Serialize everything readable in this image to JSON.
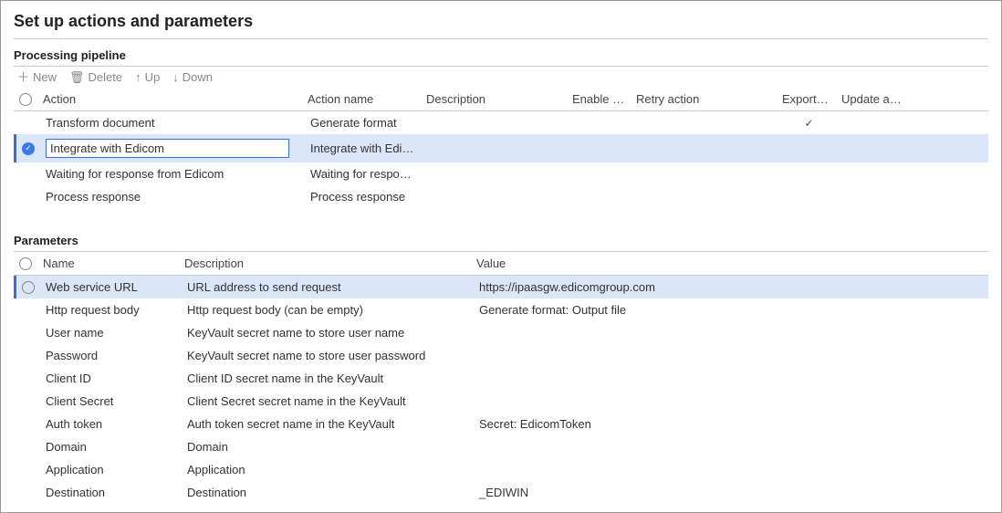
{
  "page": {
    "title": "Set up actions and parameters"
  },
  "pipeline": {
    "label": "Processing pipeline",
    "toolbar": {
      "new": "New",
      "delete": "Delete",
      "up": "Up",
      "down": "Down"
    },
    "headers": {
      "action": "Action",
      "action_name": "Action name",
      "description": "Description",
      "enable_retry": "Enable retry",
      "retry_action": "Retry action",
      "export_result": "Export result",
      "update_act": "Update act..."
    },
    "rows": [
      {
        "selected": false,
        "action": "Transform document",
        "action_name": "Generate format",
        "description": "",
        "enable_retry": "",
        "retry_action": "",
        "export_result": "✓",
        "update_act": ""
      },
      {
        "selected": true,
        "action": "Integrate with Edicom",
        "action_name": "Integrate with Edicom",
        "description": "",
        "enable_retry": "",
        "retry_action": "",
        "export_result": "",
        "update_act": ""
      },
      {
        "selected": false,
        "action": "Waiting for response from Edicom",
        "action_name": "Waiting for response fro...",
        "description": "",
        "enable_retry": "",
        "retry_action": "",
        "export_result": "",
        "update_act": ""
      },
      {
        "selected": false,
        "action": "Process response",
        "action_name": "Process response",
        "description": "",
        "enable_retry": "",
        "retry_action": "",
        "export_result": "",
        "update_act": ""
      }
    ]
  },
  "parameters": {
    "label": "Parameters",
    "headers": {
      "name": "Name",
      "description": "Description",
      "value": "Value"
    },
    "rows": [
      {
        "selected": true,
        "name": "Web service URL",
        "description": "URL address to send request",
        "value": "https://ipaasgw.edicomgroup.com"
      },
      {
        "selected": false,
        "name": "Http request body",
        "description": "Http request body (can be empty)",
        "value": "Generate format: Output file"
      },
      {
        "selected": false,
        "name": "User name",
        "description": "KeyVault secret name to store user name",
        "value": ""
      },
      {
        "selected": false,
        "name": "Password",
        "description": "KeyVault secret name to store user password",
        "value": ""
      },
      {
        "selected": false,
        "name": "Client ID",
        "description": "Client ID secret name in the KeyVault",
        "value": ""
      },
      {
        "selected": false,
        "name": "Client Secret",
        "description": "Client Secret secret name in the KeyVault",
        "value": ""
      },
      {
        "selected": false,
        "name": "Auth token",
        "description": "Auth token secret name in the KeyVault",
        "value": "Secret:  EdicomToken"
      },
      {
        "selected": false,
        "name": "Domain",
        "description": "Domain",
        "value": ""
      },
      {
        "selected": false,
        "name": "Application",
        "description": "Application",
        "value": ""
      },
      {
        "selected": false,
        "name": "Destination",
        "description": "Destination",
        "value": "_EDIWIN"
      }
    ]
  }
}
